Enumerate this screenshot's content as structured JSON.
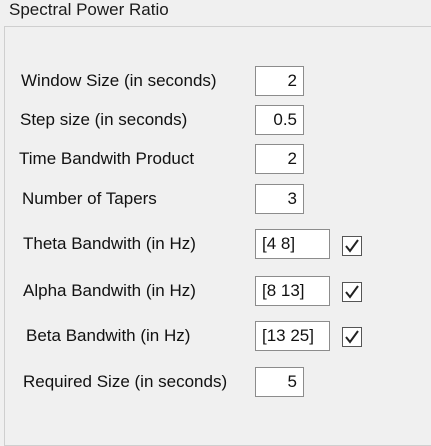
{
  "panel": {
    "title": "Spectral Power Ratio"
  },
  "fields": {
    "window_size": {
      "label": "Window Size (in seconds)",
      "value": "2"
    },
    "step_size": {
      "label": "Step size (in seconds)",
      "value": "0.5"
    },
    "tbp": {
      "label": "Time Bandwith Product",
      "value": "2"
    },
    "tapers": {
      "label": "Number of Tapers",
      "value": "3"
    },
    "theta": {
      "label": "Theta Bandwith (in Hz)",
      "value": "[4 8]",
      "checked": true
    },
    "alpha": {
      "label": "Alpha Bandwith (in Hz)",
      "value": "[8 13]",
      "checked": true
    },
    "beta": {
      "label": "Beta Bandwith (in Hz)",
      "value": "[13 25]",
      "checked": true
    },
    "required_size": {
      "label": "Required Size (in seconds)",
      "value": "5"
    }
  },
  "icons": {
    "checkbox": "checkmark-icon"
  }
}
